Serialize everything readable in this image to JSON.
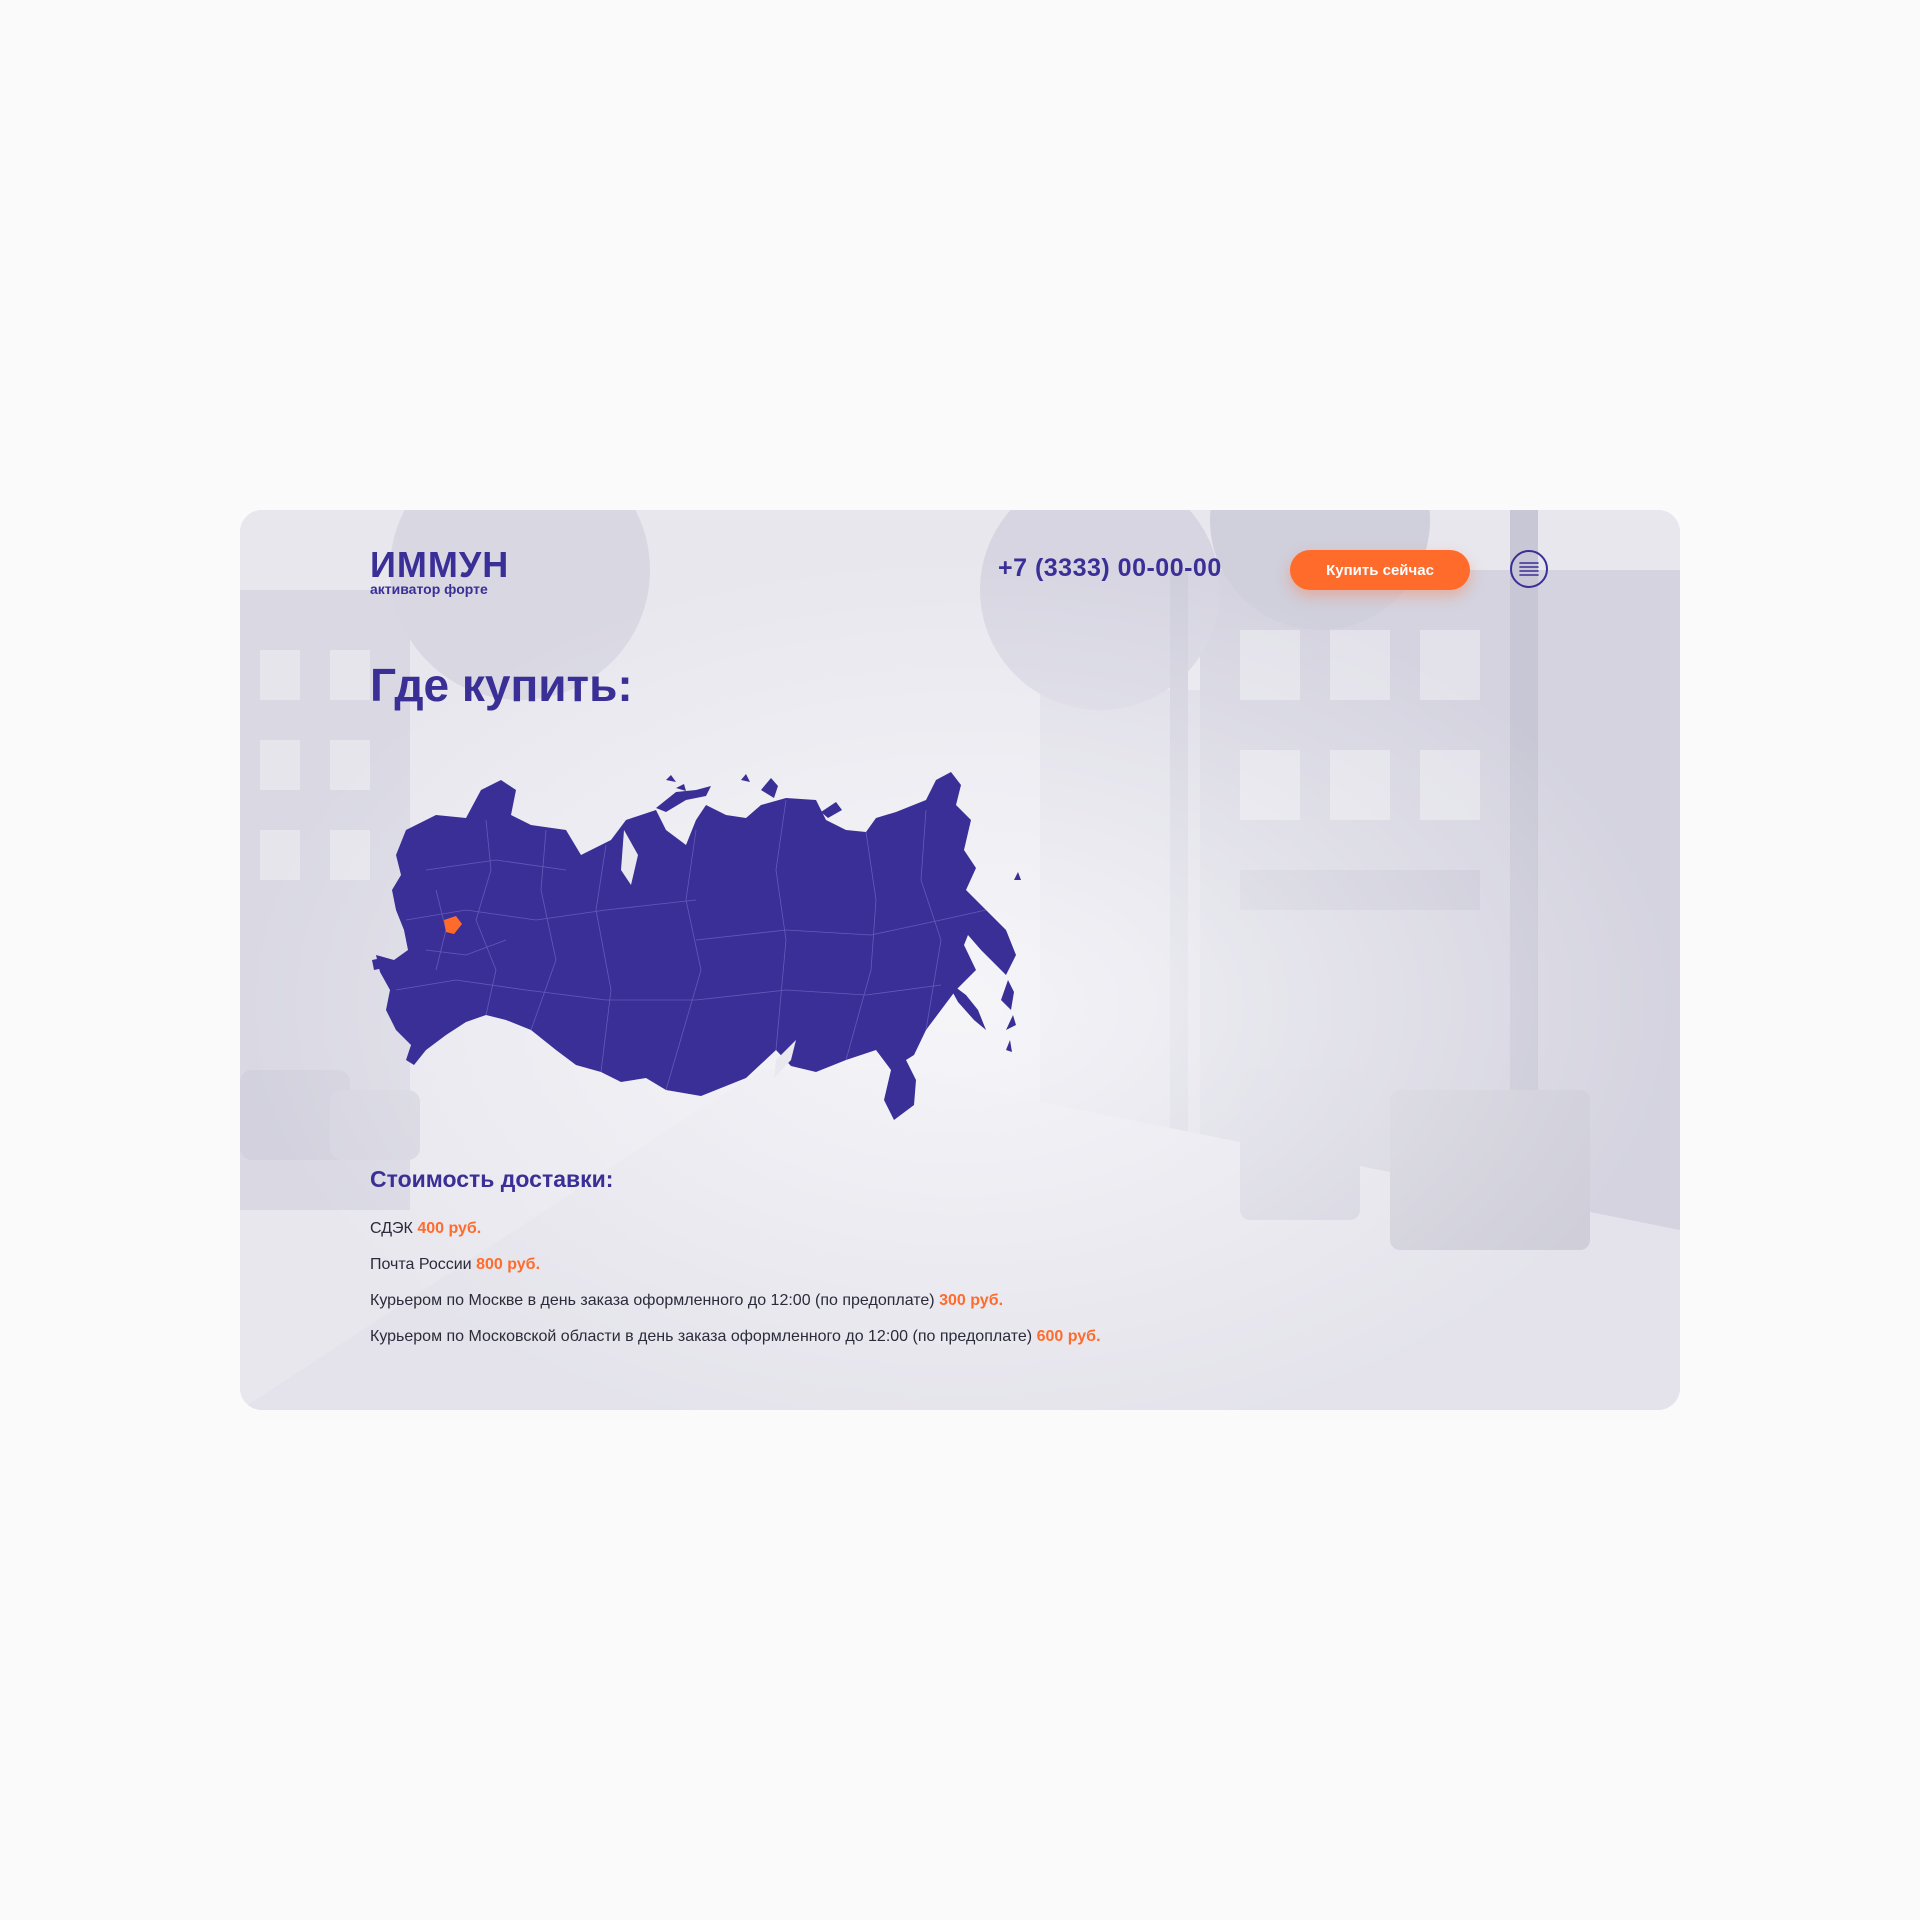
{
  "header": {
    "logo_main": "ИММУН",
    "logo_sub": "активатор форте",
    "phone": "+7 (3333) 00-00-00",
    "buy_label": "Купить сейчас",
    "menu_icon": "hamburger-menu-icon"
  },
  "page_title": "Где купить:",
  "map": {
    "fill_color": "#3a2f96",
    "highlight_color": "#ff6b2b",
    "icon": "russia-map"
  },
  "delivery": {
    "title": "Стоимость доставки:",
    "items": [
      {
        "label": "СДЭК",
        "price": "400 руб."
      },
      {
        "label": "Почта России",
        "price": "800 руб."
      },
      {
        "label": "Курьером по Москве в день заказа оформленного до 12:00 (по предоплате)",
        "price": "300 руб."
      },
      {
        "label": "Курьером по Московской области в день заказа оформленного до 12:00 (по предоплате)",
        "price": "600 руб."
      }
    ]
  },
  "colors": {
    "brand": "#3a2f96",
    "accent": "#ff6b2b",
    "page_bg": "#fafafa",
    "card_bg": "#e9e8ef"
  }
}
